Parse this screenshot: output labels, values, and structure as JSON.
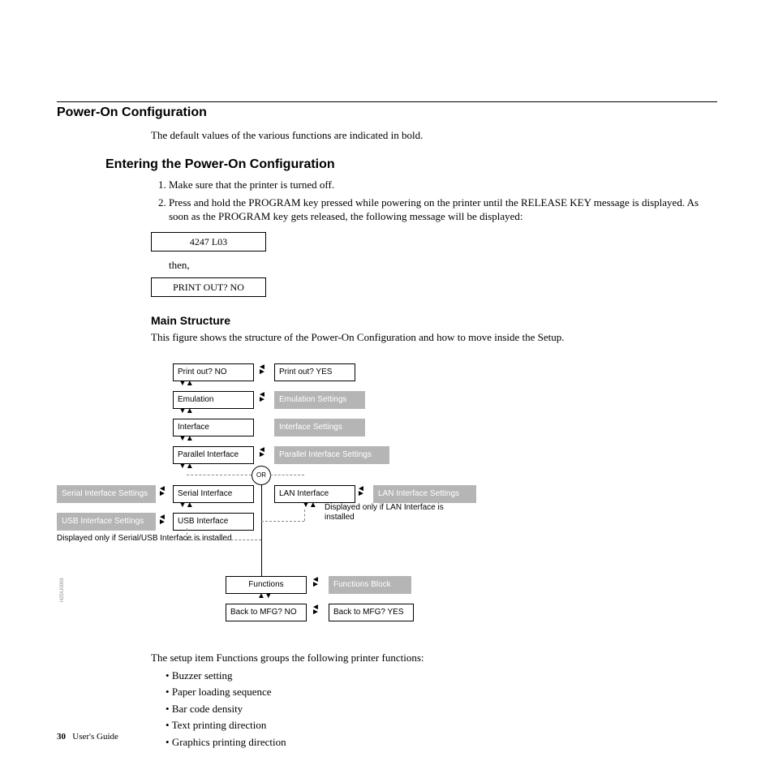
{
  "header": {
    "title": "Power-On Configuration",
    "intro": "The default values of the various functions are indicated in bold."
  },
  "section1": {
    "title": "Entering the Power-On Configuration",
    "steps": [
      "Make sure that the printer is turned off.",
      "Press and hold the PROGRAM key pressed while powering on the printer until the RELEASE KEY message is displayed. As soon as the PROGRAM key gets released, the following message will be displayed:"
    ],
    "display1": "4247 L03",
    "then": "then,",
    "display2": "PRINT OUT? NO"
  },
  "section2": {
    "title": "Main Structure",
    "intro": "This figure shows the structure of the Power-On Configuration and how to move inside the Setup."
  },
  "diagram": {
    "col1": [
      "Print out? NO",
      "Emulation",
      "Interface",
      "Parallel Interface",
      "Serial Interface",
      "USB Interface"
    ],
    "col2": [
      "Print out? YES",
      "Emulation Settings",
      "Interface Settings",
      "Parallel Interface Settings",
      "LAN Interface",
      "LAN Interface Settings"
    ],
    "leftgrey": [
      "Serial Interface Settings",
      "USB Interface Settings"
    ],
    "or": "OR",
    "note_left": "Displayed only if Serial/USB Interface is installed",
    "note_right": "Displayed only if LAN Interface is installed",
    "bottom": [
      "Functions",
      "Functions Block",
      "Back to MFG? NO",
      "Back to MFG? YES"
    ],
    "sidecode": "H2DU0009"
  },
  "tail": {
    "intro": "The setup item Functions groups the following printer functions:",
    "items": [
      "Buzzer setting",
      "Paper loading sequence",
      "Bar code density",
      "Text printing direction",
      "Graphics printing direction"
    ]
  },
  "footer": {
    "page": "30",
    "doc": "User's Guide"
  }
}
